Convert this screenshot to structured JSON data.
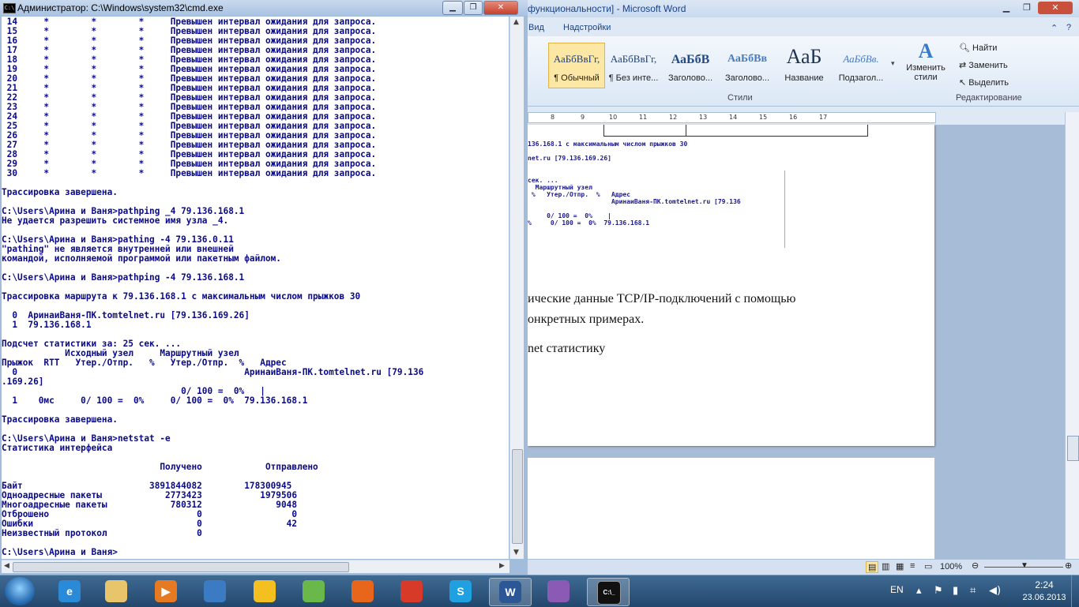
{
  "word": {
    "title": "функциональности] - Microsoft Word",
    "tabs": [
      "Вид",
      "Надстройки"
    ],
    "styles": [
      {
        "sample": "АаБбВвГг,",
        "label": "¶ Обычный"
      },
      {
        "sample": "АаБбВвГг,",
        "label": "¶ Без инте..."
      },
      {
        "sample": "АаБбВ",
        "label": "Заголово..."
      },
      {
        "sample": "АаБбВв",
        "label": "Заголово..."
      },
      {
        "sample": "АаБ",
        "label": "Название"
      },
      {
        "sample": "АаБбВв.",
        "label": "Подзагол..."
      }
    ],
    "change_styles_label": "Изменить стили",
    "groups": {
      "styles": "Стили",
      "editing": "Редактирование"
    },
    "editing": {
      "find": "Найти",
      "replace": "Заменить",
      "select": "Выделить"
    },
    "ruler_numbers": [
      "8",
      "9",
      "10",
      "11",
      "12",
      "13",
      "14",
      "15",
      "16",
      "17"
    ],
    "page_image_lines": [
      "136.168.1 с максимальным числом прыжков 30",
      "net.ru [79.136.169.26]",
      "сек. ...",
      "  Маршрутный узел",
      " %   Утер./Отпр.  %   Адрес",
      "                      АринаиВаня-ПК.tomtelnet.ru [79.136",
      "     0/ 100 =  0%    |",
      "%     0/ 100 =  0%  79.136.168.1"
    ],
    "page_text": [
      "ические данные TCP/IP-подключений с помощью",
      "онкретных примерах.",
      "net статистику"
    ],
    "zoom": "100%"
  },
  "cmd": {
    "title": "Администратор: C:\\Windows\\system32\\cmd.exe",
    "lines": [
      " 14     *        *        *     Превышен интервал ожидания для запроса.",
      " 15     *        *        *     Превышен интервал ожидания для запроса.",
      " 16     *        *        *     Превышен интервал ожидания для запроса.",
      " 17     *        *        *     Превышен интервал ожидания для запроса.",
      " 18     *        *        *     Превышен интервал ожидания для запроса.",
      " 19     *        *        *     Превышен интервал ожидания для запроса.",
      " 20     *        *        *     Превышен интервал ожидания для запроса.",
      " 21     *        *        *     Превышен интервал ожидания для запроса.",
      " 22     *        *        *     Превышен интервал ожидания для запроса.",
      " 23     *        *        *     Превышен интервал ожидания для запроса.",
      " 24     *        *        *     Превышен интервал ожидания для запроса.",
      " 25     *        *        *     Превышен интервал ожидания для запроса.",
      " 26     *        *        *     Превышен интервал ожидания для запроса.",
      " 27     *        *        *     Превышен интервал ожидания для запроса.",
      " 28     *        *        *     Превышен интервал ожидания для запроса.",
      " 29     *        *        *     Превышен интервал ожидания для запроса.",
      " 30     *        *        *     Превышен интервал ожидания для запроса.",
      "",
      "Трассировка завершена.",
      "",
      "C:\\Users\\Арина и Ваня>pathping _4 79.136.168.1",
      "Не удается разрешить системное имя узла _4.",
      "",
      "C:\\Users\\Арина и Ваня>pathing -4 79.136.0.11",
      "\"pathing\" не является внутренней или внешней",
      "командой, исполняемой программой или пакетным файлом.",
      "",
      "C:\\Users\\Арина и Ваня>pathping -4 79.136.168.1",
      "",
      "Трассировка маршрута к 79.136.168.1 с максимальным числом прыжков 30",
      "",
      "  0  АринаиВаня-ПК.tomtelnet.ru [79.136.169.26]",
      "  1  79.136.168.1",
      "",
      "Подсчет статистики за: 25 сек. ...",
      "            Исходный узел     Маршрутный узел",
      "Прыжок  RTT   Утер./Отпр.   %   Утер./Отпр.  %   Адрес",
      "  0                                           АринаиВаня-ПК.tomtelnet.ru [79.136",
      ".169.26]",
      "                                  0/ 100 =  0%   |",
      "  1    0мс     0/ 100 =  0%     0/ 100 =  0%  79.136.168.1",
      "",
      "Трассировка завершена.",
      "",
      "C:\\Users\\Арина и Ваня>netstat -e",
      "Статистика интерфейса",
      "",
      "                              Получено            Отправлено",
      "",
      "Байт                        3891844082        178300945",
      "Одноадресные пакеты            2773423           1979506",
      "Многоадресные пакеты            780312              9048",
      "Отброшено                            0                 0",
      "Ошибки                               0                42",
      "Неизвестный протокол                 0",
      "",
      "C:\\Users\\Арина и Ваня>"
    ]
  },
  "taskbar": {
    "apps": [
      {
        "name": "ie",
        "label": "e",
        "color": "#2a8ad8"
      },
      {
        "name": "explorer",
        "label": "",
        "color": "#e8c46a"
      },
      {
        "name": "media-player",
        "label": "▶",
        "color": "#e67a22"
      },
      {
        "name": "network",
        "label": "",
        "color": "#3b7bc4"
      },
      {
        "name": "chrome-canary",
        "label": "",
        "color": "#f4c020"
      },
      {
        "name": "wifi",
        "label": "",
        "color": "#6bb84a"
      },
      {
        "name": "firefox",
        "label": "",
        "color": "#e8661c"
      },
      {
        "name": "chrome",
        "label": "",
        "color": "#d83a2a"
      },
      {
        "name": "skype",
        "label": "S",
        "color": "#1fa0e0"
      },
      {
        "name": "word",
        "label": "W",
        "color": "#2b5797"
      },
      {
        "name": "onenote",
        "label": "",
        "color": "#8a5ab4"
      },
      {
        "name": "cmd",
        "label": "C:\\_",
        "color": "#111111"
      }
    ],
    "language": "EN",
    "time": "2:24",
    "date": "23.06.2013"
  }
}
